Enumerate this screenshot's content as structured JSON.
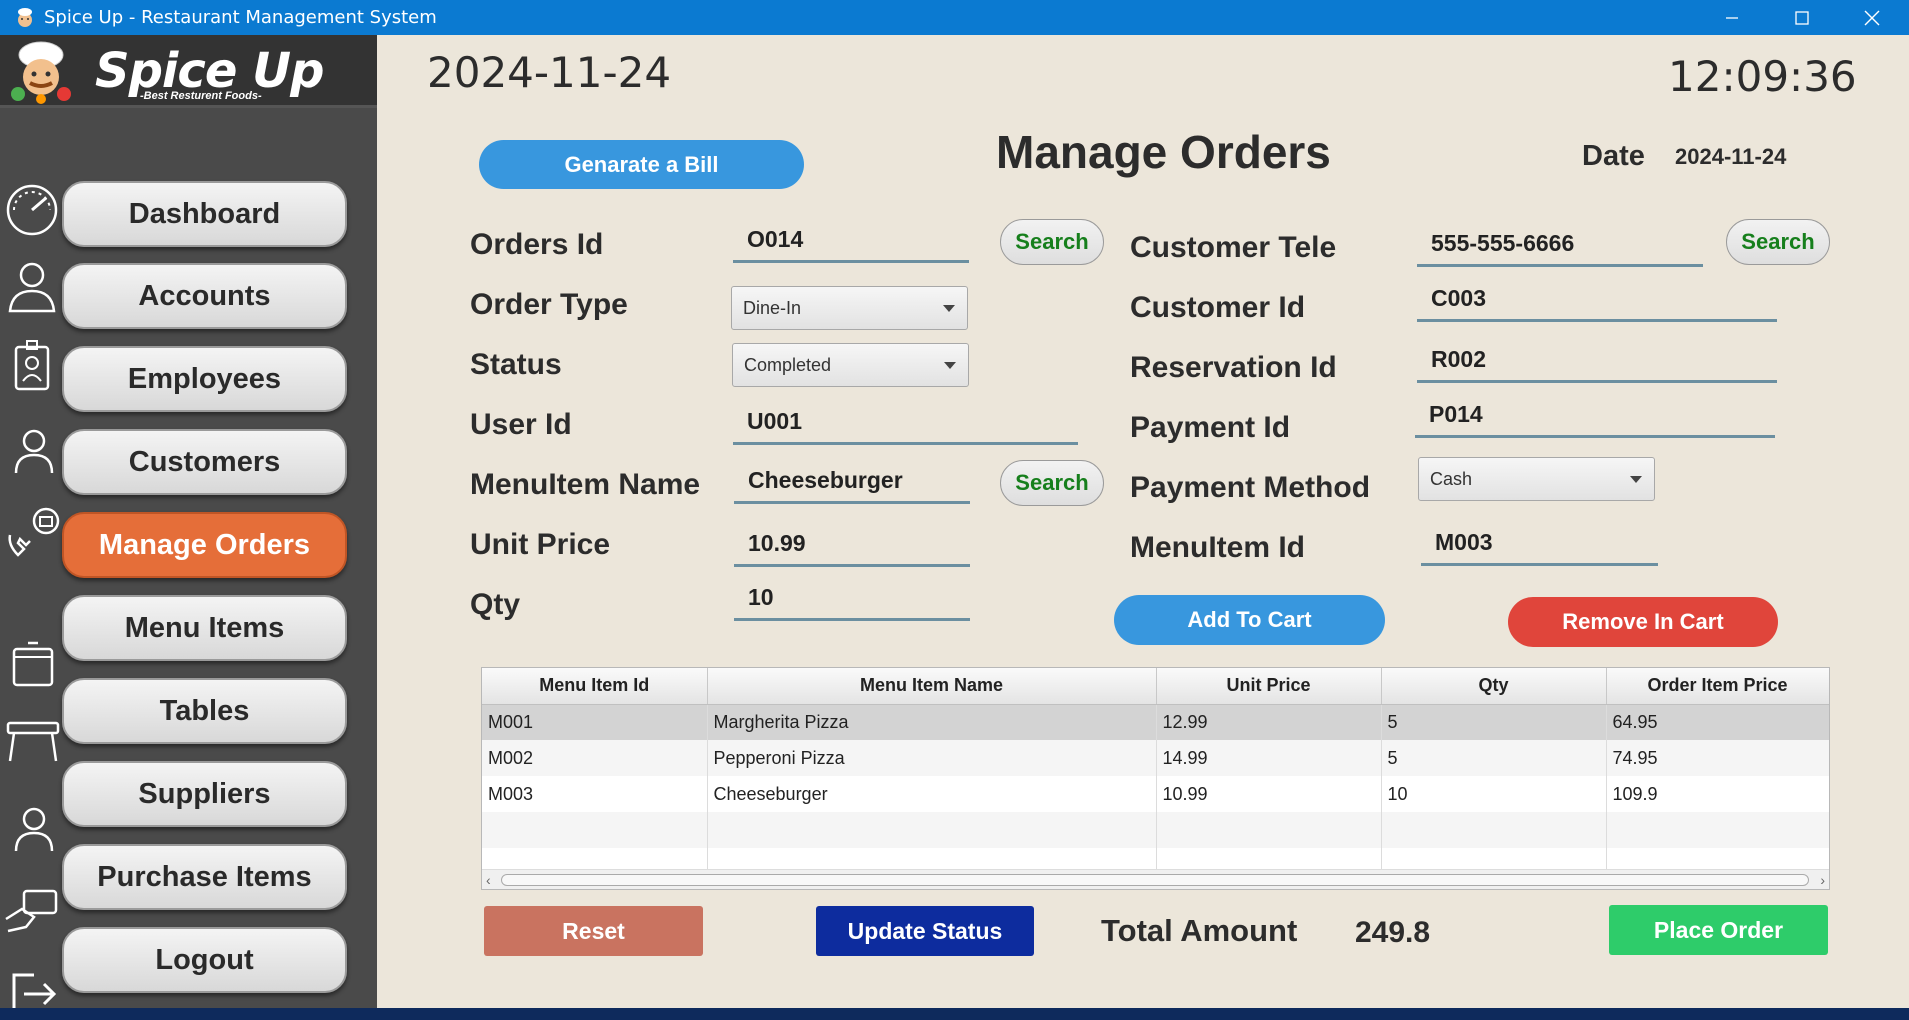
{
  "window": {
    "title": "Spice Up - Restaurant Management System",
    "controls": [
      "minimize",
      "maximize",
      "close"
    ]
  },
  "brand": {
    "name": "Spice Up",
    "tagline": "-Best Resturent Foods-"
  },
  "sidebar": {
    "items": [
      {
        "label": "Dashboard",
        "icon": "speedometer-icon"
      },
      {
        "label": "Accounts",
        "icon": "person-bust-icon"
      },
      {
        "label": "Employees",
        "icon": "id-badge-icon"
      },
      {
        "label": "Customers",
        "icon": "person-icon"
      },
      {
        "label": "Manage Orders",
        "icon": "phone-order-icon",
        "active": true
      },
      {
        "label": "Menu Items",
        "icon": "box-icon"
      },
      {
        "label": "Tables",
        "icon": "table-icon"
      },
      {
        "label": "Suppliers",
        "icon": "person-icon"
      },
      {
        "label": "Purchase Items",
        "icon": "card-payment-icon"
      },
      {
        "label": "Logout",
        "icon": "logout-icon"
      }
    ]
  },
  "header": {
    "date": "2024-11-24",
    "time": "12:09:36",
    "page_title": "Manage Orders",
    "date_label": "Date",
    "date_value": "2024-11-24",
    "generate_bill_label": "Genarate a Bill"
  },
  "form_left": {
    "orders_id": {
      "label": "Orders Id",
      "value": "O014"
    },
    "order_type": {
      "label": "Order Type",
      "value": "Dine-In"
    },
    "status": {
      "label": "Status",
      "value": "Completed"
    },
    "user_id": {
      "label": "User Id",
      "value": "U001"
    },
    "menu_item_name": {
      "label": "MenuItem Name",
      "value": "Cheeseburger"
    },
    "unit_price": {
      "label": "Unit Price",
      "value": "10.99"
    },
    "qty": {
      "label": "Qty",
      "value": "10"
    },
    "search_label": "Search"
  },
  "form_right": {
    "customer_tele": {
      "label": "Customer Tele",
      "value": "555-555-6666"
    },
    "customer_id": {
      "label": "Customer Id",
      "value": "C003"
    },
    "reservation_id": {
      "label": "Reservation Id",
      "value": "R002"
    },
    "payment_id": {
      "label": "Payment Id",
      "value": "P014"
    },
    "payment_method": {
      "label": "Payment Method",
      "value": "Cash"
    },
    "menu_item_id": {
      "label": "MenuItem Id",
      "value": "M003"
    },
    "search_label": "Search"
  },
  "cart_actions": {
    "add_label": "Add To Cart",
    "remove_label": "Remove In Cart"
  },
  "cart_table": {
    "columns": [
      "Menu Item Id",
      "Menu Item Name",
      "Unit Price",
      "Qty",
      "Order Item Price"
    ],
    "rows": [
      [
        "M001",
        "Margherita Pizza",
        "12.99",
        "5",
        "64.95"
      ],
      [
        "M002",
        "Pepperoni Pizza",
        "14.99",
        "5",
        "74.95"
      ],
      [
        "M003",
        "Cheeseburger",
        "10.99",
        "10",
        "109.9"
      ]
    ]
  },
  "footer": {
    "reset_label": "Reset",
    "update_status_label": "Update Status",
    "total_label": "Total Amount",
    "total_value": "249.8",
    "place_order_label": "Place Order"
  },
  "colors": {
    "titlebar": "#0b7ad1",
    "sidebar": "#4a4a4a",
    "active_nav": "#e56e39",
    "background": "#ece6da",
    "blue_button": "#3897de",
    "red_button": "#e0453b",
    "reset_button": "#c97360",
    "update_button": "#0d2c9e",
    "place_order_button": "#2ecc6a",
    "search_text": "#167f1c"
  }
}
